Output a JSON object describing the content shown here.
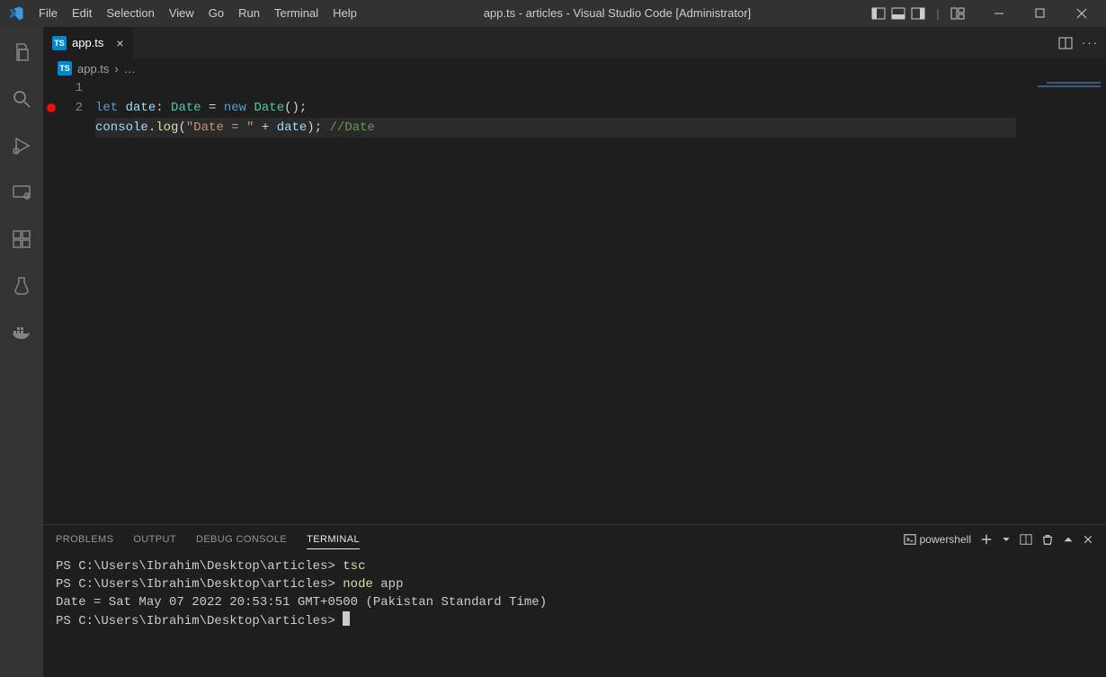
{
  "window": {
    "title": "app.ts - articles - Visual Studio Code [Administrator]"
  },
  "menu": {
    "items": [
      "File",
      "Edit",
      "Selection",
      "View",
      "Go",
      "Run",
      "Terminal",
      "Help"
    ]
  },
  "tabs": {
    "open": [
      {
        "label": "app.ts"
      }
    ]
  },
  "breadcrumb": {
    "file": "app.ts",
    "tail": "…"
  },
  "editor": {
    "line_numbers": [
      "1",
      "2"
    ],
    "breakpoints": [
      false,
      true
    ],
    "current_line_index": 1,
    "code": {
      "l1": {
        "kw_let": "let",
        "var_date": "date",
        "colon": ": ",
        "type_Date": "Date",
        "eq": " = ",
        "kw_new": "new",
        "sp": " ",
        "ctor_Date": "Date",
        "parens_semi": "();"
      },
      "l2": {
        "obj_console": "console",
        "dot": ".",
        "fn_log": "log",
        "open": "(",
        "str": "\"Date = \"",
        "plus": " + ",
        "var_date": "date",
        "close_semi": "); ",
        "comment": "//Date"
      }
    }
  },
  "panel": {
    "tabs": {
      "problems": "PROBLEMS",
      "output": "OUTPUT",
      "debug": "DEBUG CONSOLE",
      "terminal": "TERMINAL"
    },
    "active_tab": "terminal",
    "shell_label": "powershell"
  },
  "terminal": {
    "lines": [
      {
        "prompt": "PS C:\\Users\\Ibrahim\\Desktop\\articles> ",
        "cmd": "tsc"
      },
      {
        "prompt": "PS C:\\Users\\Ibrahim\\Desktop\\articles> ",
        "cmd": "node",
        "arg": " app"
      },
      {
        "output": "Date = Sat May 07 2022 20:53:51 GMT+0500 (Pakistan Standard Time)"
      },
      {
        "prompt": "PS C:\\Users\\Ibrahim\\Desktop\\articles> ",
        "cursor": true
      }
    ]
  }
}
